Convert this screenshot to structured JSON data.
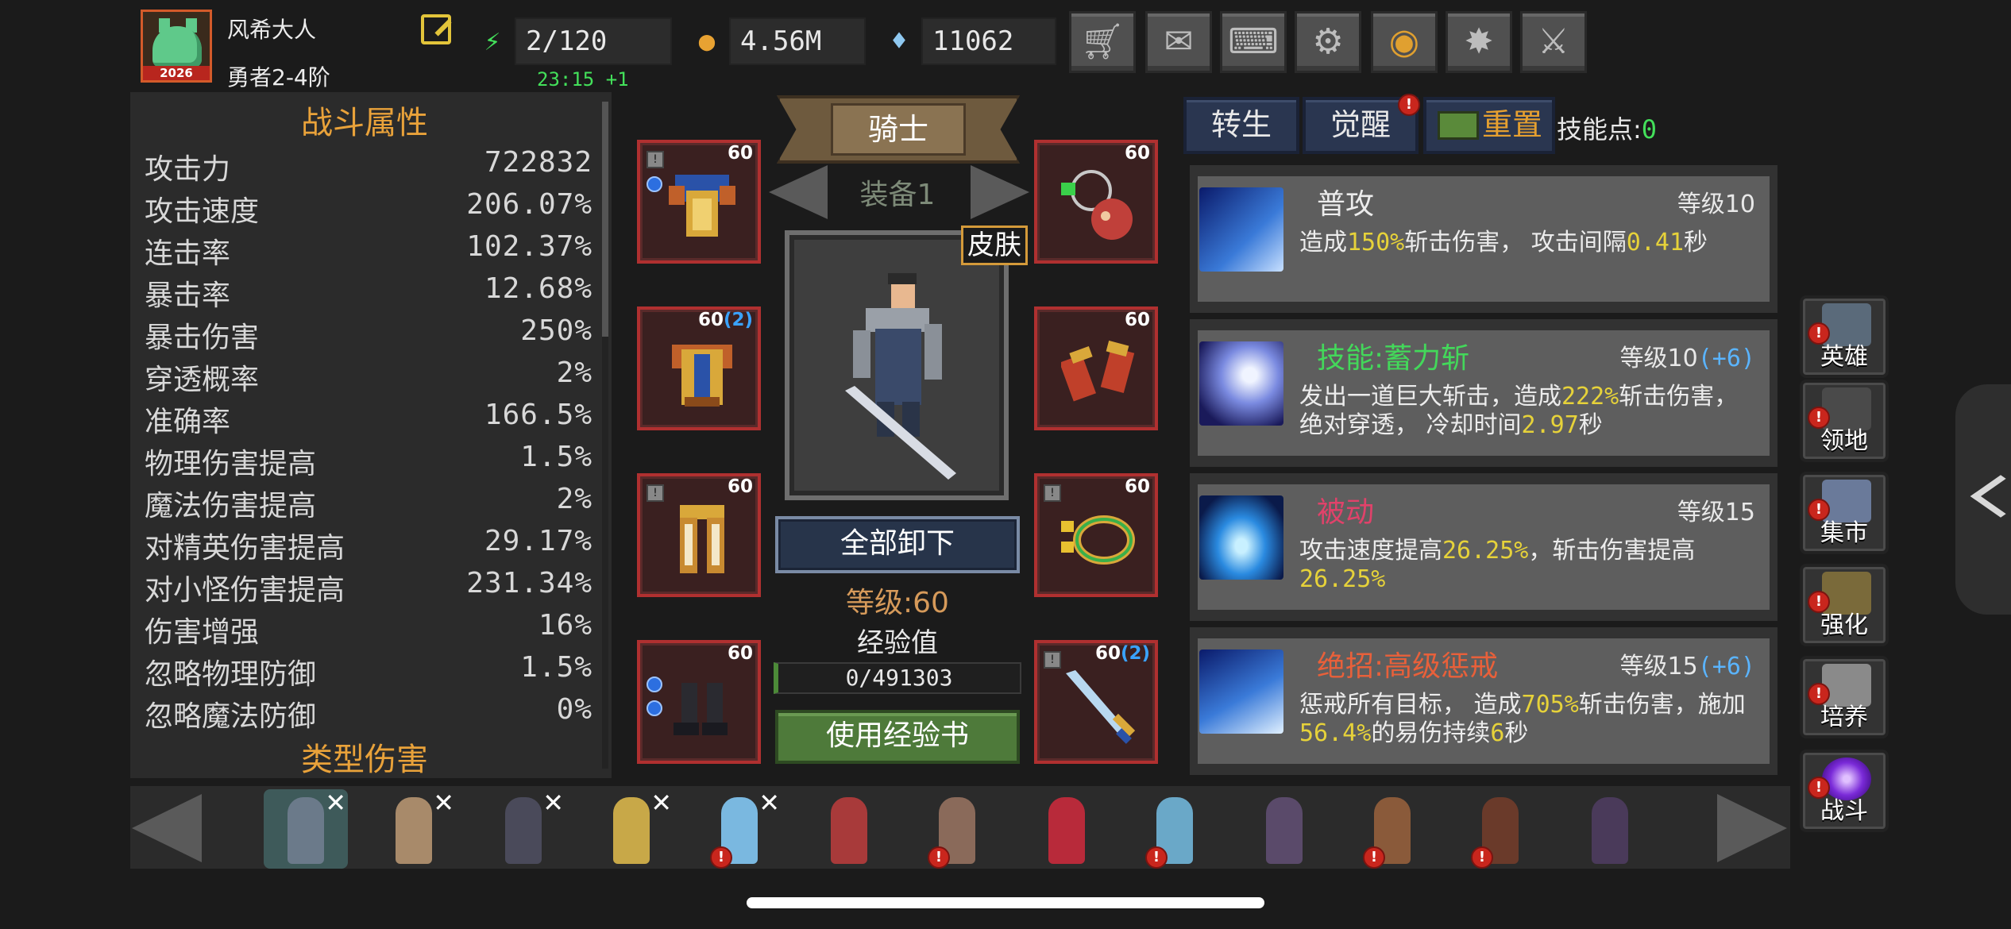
{
  "player": {
    "name": "风希大人",
    "rank": "勇者2-4阶",
    "avatar_year": "2026"
  },
  "resources": {
    "energy": "2/120",
    "energy_timer": "23:15 +1",
    "gold": "4.56M",
    "diamonds": "11062"
  },
  "top_buttons": [
    "cart-icon",
    "mail-icon",
    "gamepad-icon",
    "gear-icon",
    "aperture-icon",
    "fireworks-icon",
    "crossed-swords-icon"
  ],
  "stats": {
    "title": "战斗属性",
    "rows": [
      {
        "k": "攻击力",
        "v": "722832"
      },
      {
        "k": "攻击速度",
        "v": "206.07%"
      },
      {
        "k": "连击率",
        "v": "102.37%"
      },
      {
        "k": "暴击率",
        "v": "12.68%"
      },
      {
        "k": "暴击伤害",
        "v": "250%"
      },
      {
        "k": "穿透概率",
        "v": "2%"
      },
      {
        "k": "准确率",
        "v": "166.5%"
      },
      {
        "k": "物理伤害提高",
        "v": "1.5%"
      },
      {
        "k": "魔法伤害提高",
        "v": "2%"
      },
      {
        "k": "对精英伤害提高",
        "v": "29.17%"
      },
      {
        "k": "对小怪伤害提高",
        "v": "231.34%"
      },
      {
        "k": "伤害增强",
        "v": "16%"
      },
      {
        "k": "忽略物理防御",
        "v": "1.5%"
      },
      {
        "k": "忽略魔法防御",
        "v": "0%"
      }
    ],
    "next_section": "类型伤害"
  },
  "equipment": {
    "class_name": "骑士",
    "set_label": "装备1",
    "skin_label": "皮肤",
    "unequip_all": "全部卸下",
    "level": "等级:60",
    "exp_label": "经验值",
    "exp_value": "0/491303",
    "use_exp_book": "使用经验书",
    "slots": [
      {
        "name": "shoulder-armor",
        "lvl": "60",
        "bonus": ""
      },
      {
        "name": "necklace",
        "lvl": "60",
        "bonus": ""
      },
      {
        "name": "chest-armor",
        "lvl": "60",
        "bonus": "(2)"
      },
      {
        "name": "gloves",
        "lvl": "60",
        "bonus": ""
      },
      {
        "name": "leg-armor",
        "lvl": "60",
        "bonus": ""
      },
      {
        "name": "ring",
        "lvl": "60",
        "bonus": ""
      },
      {
        "name": "boots",
        "lvl": "60",
        "bonus": ""
      },
      {
        "name": "sword",
        "lvl": "60",
        "bonus": "(2)"
      }
    ]
  },
  "skills_panel": {
    "tab_rebirth": "转生",
    "tab_awaken": "觉醒",
    "tab_reset": "重置",
    "skill_points_label": "技能点:",
    "skill_points": "0",
    "skills": [
      {
        "name": "普攻",
        "name_color": "#ececec",
        "level": "等级10",
        "bonus": "",
        "desc": [
          {
            "t": "造成"
          },
          {
            "t": "150%",
            "hl": true
          },
          {
            "t": "斩击伤害， 攻击间隔"
          },
          {
            "t": "0.41",
            "hl": true
          },
          {
            "t": "秒"
          }
        ]
      },
      {
        "name": "技能:蓄力斩",
        "name_color": "#43d85a",
        "level": "等级10",
        "bonus": "(+6)",
        "desc": [
          {
            "t": "发出一道巨大斩击，造成"
          },
          {
            "t": "222%",
            "hl": true
          },
          {
            "t": "斩击伤害，绝对穿透， 冷却时间"
          },
          {
            "t": "2.97",
            "hl": true
          },
          {
            "t": "秒"
          }
        ]
      },
      {
        "name": "被动",
        "name_color": "#e0426a",
        "level": "等级15",
        "bonus": "",
        "desc": [
          {
            "t": "攻击速度提高"
          },
          {
            "t": "26.25%",
            "hl": true
          },
          {
            "t": "，斩击伤害提高"
          },
          {
            "t": "26.25%",
            "hl": true
          }
        ]
      },
      {
        "name": "绝招:高级惩戒",
        "name_color": "#e8603a",
        "level": "等级15",
        "bonus": "(+6)",
        "desc": [
          {
            "t": "惩戒所有目标， 造成"
          },
          {
            "t": "705%",
            "hl": true
          },
          {
            "t": "斩击伤害，施加"
          },
          {
            "t": "56.4%",
            "hl": true
          },
          {
            "t": "的易伤持续"
          },
          {
            "t": "6",
            "hl": true
          },
          {
            "t": "秒"
          }
        ]
      }
    ]
  },
  "side_nav": [
    {
      "label": "英雄",
      "icon": "helmet-icon"
    },
    {
      "label": "领地",
      "icon": "castle-icon"
    },
    {
      "label": "集市",
      "icon": "market-icon"
    },
    {
      "label": "强化",
      "icon": "emblem-icon"
    },
    {
      "label": "培养",
      "icon": "chalice-icon"
    },
    {
      "label": "战斗",
      "icon": "portal-icon"
    }
  ],
  "roster": [
    {
      "name": "knight",
      "selected": true,
      "x": true,
      "alert": false,
      "color": "#6b7a8a"
    },
    {
      "name": "amazon",
      "selected": false,
      "x": true,
      "alert": false,
      "color": "#a88a6a"
    },
    {
      "name": "dark-knight",
      "selected": false,
      "x": true,
      "alert": false,
      "color": "#4a4a5a"
    },
    {
      "name": "elf-archer",
      "selected": false,
      "x": true,
      "alert": false,
      "color": "#c8a848"
    },
    {
      "name": "ice-mage",
      "selected": false,
      "x": true,
      "alert": true,
      "color": "#7ab8e0"
    },
    {
      "name": "sorceress",
      "selected": false,
      "x": false,
      "alert": false,
      "color": "#a83a3a"
    },
    {
      "name": "gunner",
      "selected": false,
      "x": false,
      "alert": true,
      "color": "#8a6a5a"
    },
    {
      "name": "vampire",
      "selected": false,
      "x": false,
      "alert": false,
      "color": "#b82a3a"
    },
    {
      "name": "frost-spirit",
      "selected": false,
      "x": false,
      "alert": true,
      "color": "#6aa8c8"
    },
    {
      "name": "warlock",
      "selected": false,
      "x": false,
      "alert": false,
      "color": "#5a4a6a"
    },
    {
      "name": "barbarian",
      "selected": false,
      "x": false,
      "alert": true,
      "color": "#8a5a3a"
    },
    {
      "name": "demon-hunter",
      "selected": false,
      "x": false,
      "alert": true,
      "color": "#6a3a2a"
    },
    {
      "name": "assassin",
      "selected": false,
      "x": false,
      "alert": false,
      "color": "#4a3a5a"
    }
  ]
}
